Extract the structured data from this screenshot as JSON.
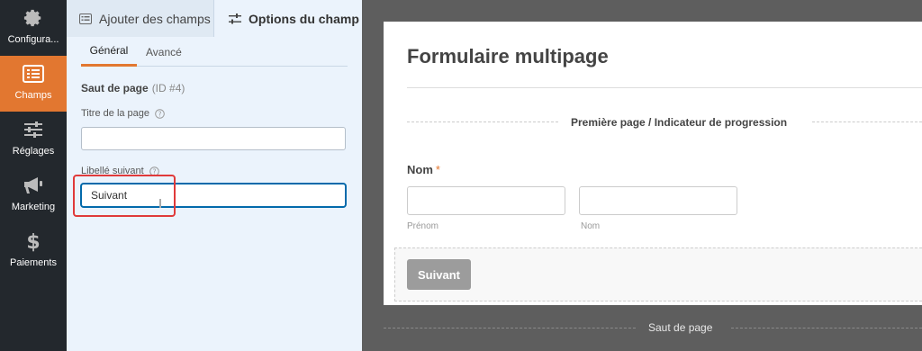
{
  "sidebar": {
    "items": [
      {
        "label": "Configura...",
        "icon": "gear-icon"
      },
      {
        "label": "Champs",
        "icon": "form-fields-icon"
      },
      {
        "label": "Réglages",
        "icon": "sliders-icon"
      },
      {
        "label": "Marketing",
        "icon": "megaphone-icon"
      },
      {
        "label": "Paiements",
        "icon": "dollar-icon"
      }
    ]
  },
  "panel": {
    "tabs": [
      {
        "label": "Ajouter des champs",
        "icon": "list-icon"
      },
      {
        "label": "Options du champ",
        "icon": "sliders-icon"
      }
    ],
    "subtabs": [
      "Général",
      "Avancé"
    ],
    "field_title": "Saut de page",
    "field_id": "(ID #4)",
    "page_title_label": "Titre de la page",
    "page_title_value": "",
    "next_label_label": "Libellé suivant",
    "next_label_value": "Suivant"
  },
  "preview": {
    "form_title": "Formulaire multipage",
    "progress_label": "Première page / Indicateur de progression",
    "name_label": "Nom",
    "required_mark": "*",
    "first_sublabel": "Prénom",
    "last_sublabel": "Nom",
    "next_button": "Suivant",
    "page_break_label": "Saut de page"
  },
  "colors": {
    "accent": "#e27730",
    "sidebar_bg": "#23282d",
    "panel_bg": "#ebf3fc",
    "highlight": "#e03a3a",
    "focus": "#036aab"
  }
}
